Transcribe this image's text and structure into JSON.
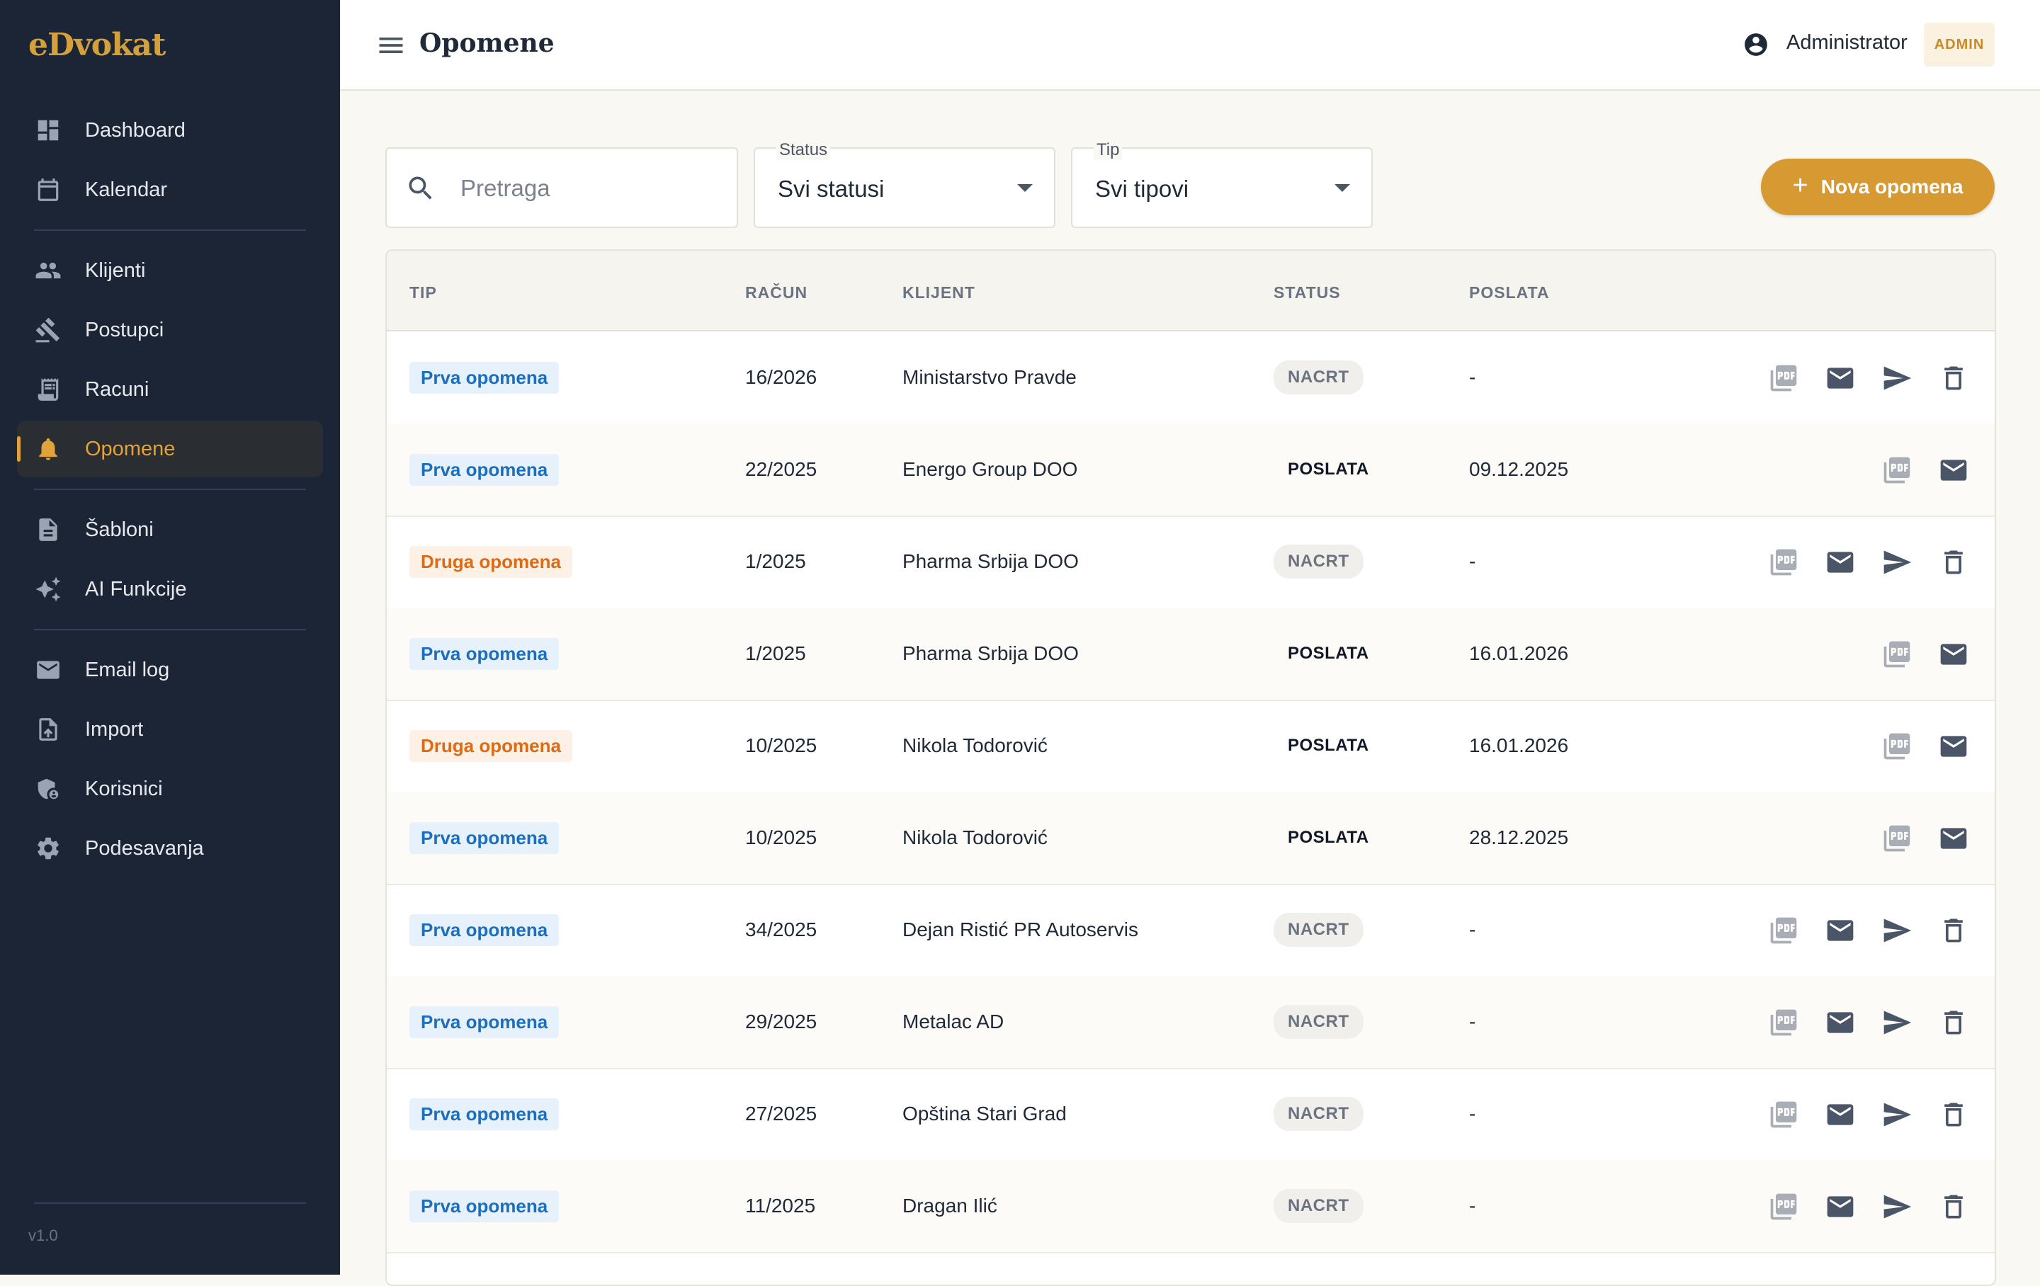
{
  "app": {
    "logo": "eDvokat",
    "version": "v1.0"
  },
  "sidebar": {
    "items": [
      {
        "label": "Dashboard",
        "icon": "dashboard-icon"
      },
      {
        "label": "Kalendar",
        "icon": "calendar-icon"
      },
      {
        "label": "Klijenti",
        "icon": "people-icon"
      },
      {
        "label": "Postupci",
        "icon": "gavel-icon"
      },
      {
        "label": "Racuni",
        "icon": "receipt-icon"
      },
      {
        "label": "Opomene",
        "icon": "bell-icon",
        "active": true
      },
      {
        "label": "Šabloni",
        "icon": "document-icon"
      },
      {
        "label": "AI Funkcije",
        "icon": "sparkle-icon"
      },
      {
        "label": "Email log",
        "icon": "mail-icon"
      },
      {
        "label": "Import",
        "icon": "upload-file-icon"
      },
      {
        "label": "Korisnici",
        "icon": "admin-shield-icon"
      },
      {
        "label": "Podesavanja",
        "icon": "gear-icon"
      }
    ]
  },
  "header": {
    "title": "Opomene",
    "user_name": "Administrator",
    "role": "ADMIN"
  },
  "filters": {
    "search_placeholder": "Pretraga",
    "status": {
      "label": "Status",
      "value": "Svi statusi"
    },
    "type": {
      "label": "Tip",
      "value": "Svi tipovi"
    },
    "new_button": "Nova opomena"
  },
  "table": {
    "columns": [
      "TIP",
      "RAČUN",
      "KLIJENT",
      "STATUS",
      "POSLATA"
    ],
    "rows": [
      {
        "type": "Prva opomena",
        "type_color": "blue",
        "invoice": "16/2026",
        "client": "Ministarstvo Pravde",
        "status": "NACRT",
        "sent": "-"
      },
      {
        "type": "Prva opomena",
        "type_color": "blue",
        "invoice": "22/2025",
        "client": "Energo Group DOO",
        "status": "POSLATA",
        "sent": "09.12.2025"
      },
      {
        "type": "Druga opomena",
        "type_color": "orange",
        "invoice": "1/2025",
        "client": "Pharma Srbija DOO",
        "status": "NACRT",
        "sent": "-"
      },
      {
        "type": "Prva opomena",
        "type_color": "blue",
        "invoice": "1/2025",
        "client": "Pharma Srbija DOO",
        "status": "POSLATA",
        "sent": "16.01.2026"
      },
      {
        "type": "Druga opomena",
        "type_color": "orange",
        "invoice": "10/2025",
        "client": "Nikola Todorović",
        "status": "POSLATA",
        "sent": "16.01.2026"
      },
      {
        "type": "Prva opomena",
        "type_color": "blue",
        "invoice": "10/2025",
        "client": "Nikola Todorović",
        "status": "POSLATA",
        "sent": "28.12.2025"
      },
      {
        "type": "Prva opomena",
        "type_color": "blue",
        "invoice": "34/2025",
        "client": "Dejan Ristić PR Autoservis",
        "status": "NACRT",
        "sent": "-"
      },
      {
        "type": "Prva opomena",
        "type_color": "blue",
        "invoice": "29/2025",
        "client": "Metalac AD",
        "status": "NACRT",
        "sent": "-"
      },
      {
        "type": "Prva opomena",
        "type_color": "blue",
        "invoice": "27/2025",
        "client": "Opština Stari Grad",
        "status": "NACRT",
        "sent": "-"
      },
      {
        "type": "Prva opomena",
        "type_color": "blue",
        "invoice": "11/2025",
        "client": "Dragan Ilić",
        "status": "NACRT",
        "sent": "-"
      }
    ]
  },
  "colors": {
    "sidebar_bg": "#1c2536",
    "accent": "#d79a32",
    "badge_blue": "#1b6fbf",
    "badge_orange": "#dd6b16"
  }
}
